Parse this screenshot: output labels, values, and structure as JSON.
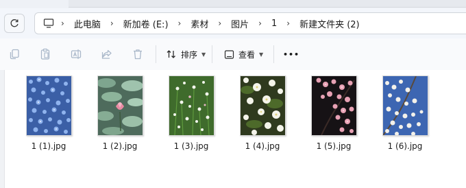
{
  "address_bar": {
    "crumbs": [
      "此电脑",
      "新加卷 (E:)",
      "素材",
      "图片",
      "1",
      "新建文件夹 (2)"
    ],
    "separator": "›"
  },
  "toolbar": {
    "sort_label": "排序",
    "view_label": "查看",
    "more_label": "•••"
  },
  "files": [
    {
      "name": "1 (1).jpg",
      "scene": "blue-flowers"
    },
    {
      "name": "1 (2).jpg",
      "scene": "lotus-pond"
    },
    {
      "name": "1 (3).jpg",
      "scene": "white-wildflowers"
    },
    {
      "name": "1 (4).jpg",
      "scene": "white-blossoms"
    },
    {
      "name": "1 (5).jpg",
      "scene": "pink-blossoms-night"
    },
    {
      "name": "1 (6).jpg",
      "scene": "white-blossoms-sky"
    }
  ],
  "colors": {
    "nav_background": "#f3f6fb",
    "toolbar_background": "#f9fafc",
    "disabled_icon": "#a9b7c9",
    "text": "#1a1a1a"
  }
}
